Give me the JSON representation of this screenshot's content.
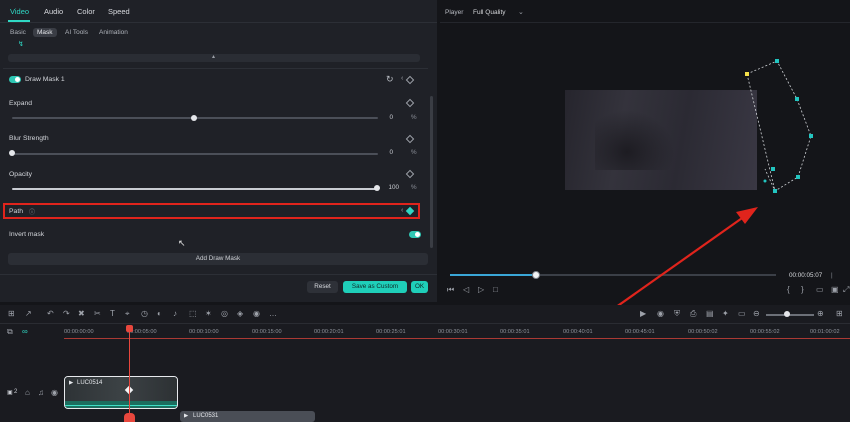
{
  "properties": {
    "main_tabs": [
      {
        "label": "Video",
        "active": true
      },
      {
        "label": "Audio",
        "active": false
      },
      {
        "label": "Color",
        "active": false
      },
      {
        "label": "Speed",
        "active": false
      }
    ],
    "sub_tabs": [
      {
        "label": "Basic",
        "active": false
      },
      {
        "label": "Mask",
        "active": true
      },
      {
        "label": "AI Tools",
        "active": false
      },
      {
        "label": "Animation",
        "active": false
      }
    ],
    "mask": {
      "name": "Draw Mask 1",
      "enabled": true,
      "expand": {
        "label": "Expand",
        "value": "0",
        "unit": "%",
        "level": 0.5
      },
      "blur": {
        "label": "Blur Strength",
        "value": "0",
        "unit": "%",
        "level": 0
      },
      "opacity": {
        "label": "Opacity",
        "value": "100",
        "unit": "%",
        "level": 1
      },
      "path_label": "Path",
      "invert_label": "Invert mask",
      "invert_on": true
    },
    "add_draw_mask": "Add Draw Mask",
    "buttons": {
      "reset": "Reset",
      "save_custom": "Save as Custom",
      "ok": "OK"
    }
  },
  "player": {
    "label": "Player",
    "quality": "Full Quality",
    "timecode": "00:00:05:07",
    "progress": 0.26
  },
  "timeline": {
    "ticks": [
      "00:00:00:00",
      "00:00:05:00",
      "00:00:10:00",
      "00:00:15:00",
      "00:00:20:01",
      "00:00:25:01",
      "00:00:30:01",
      "00:00:35:01",
      "00:00:40:01",
      "00:00:45:01",
      "00:00:50:02",
      "00:00:55:02",
      "00:01:00:02"
    ],
    "track_number": "2",
    "clips": [
      {
        "name": "LUC0514"
      },
      {
        "name": "LUC0531"
      }
    ]
  },
  "colors": {
    "accent": "#2fd8c4",
    "highlight": "#e0241c",
    "playhead": "#e8473d",
    "mask_point": "#22c5c0",
    "mask_anchor": "#f5e04a"
  }
}
